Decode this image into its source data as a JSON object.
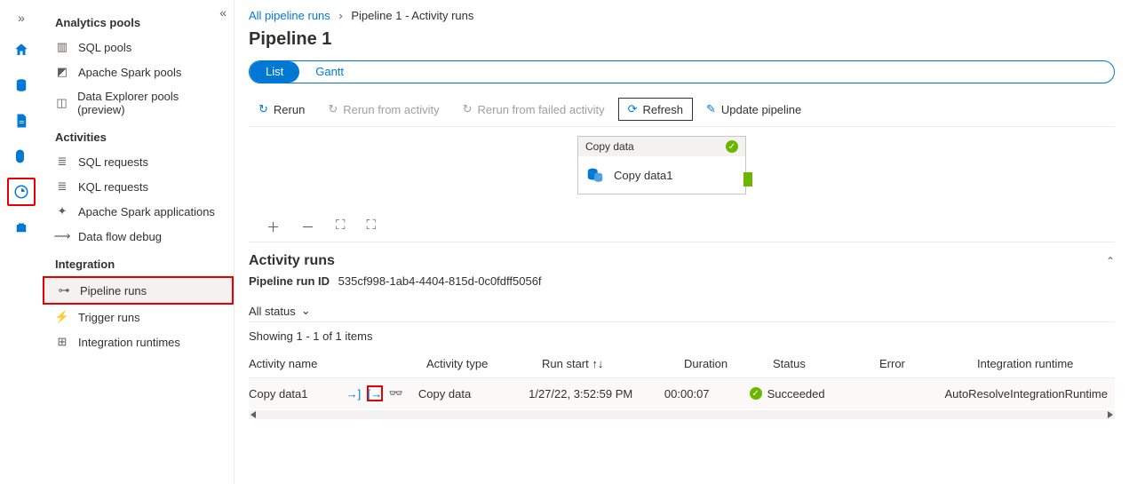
{
  "iconbar": {
    "items": [
      "home",
      "data",
      "develop",
      "integrate",
      "monitor",
      "manage"
    ],
    "selected_index": 4
  },
  "sidebar": {
    "groups": [
      {
        "title": "Analytics pools",
        "items": [
          {
            "label": "SQL pools",
            "icon": "sql-pools-icon"
          },
          {
            "label": "Apache Spark pools",
            "icon": "spark-pools-icon"
          },
          {
            "label": "Data Explorer pools (preview)",
            "icon": "data-explorer-icon"
          }
        ]
      },
      {
        "title": "Activities",
        "items": [
          {
            "label": "SQL requests",
            "icon": "sql-requests-icon"
          },
          {
            "label": "KQL requests",
            "icon": "kql-requests-icon"
          },
          {
            "label": "Apache Spark applications",
            "icon": "spark-apps-icon"
          },
          {
            "label": "Data flow debug",
            "icon": "data-flow-debug-icon"
          }
        ]
      },
      {
        "title": "Integration",
        "items": [
          {
            "label": "Pipeline runs",
            "icon": "pipeline-runs-icon",
            "selected": true
          },
          {
            "label": "Trigger runs",
            "icon": "trigger-runs-icon"
          },
          {
            "label": "Integration runtimes",
            "icon": "integration-runtimes-icon"
          }
        ]
      }
    ]
  },
  "breadcrumb": {
    "root": "All pipeline runs",
    "current": "Pipeline 1 - Activity runs"
  },
  "page_title": "Pipeline 1",
  "view_toggle": {
    "list": "List",
    "gantt": "Gantt"
  },
  "toolbar": {
    "rerun": "Rerun",
    "rerun_from_activity": "Rerun from activity",
    "rerun_from_failed": "Rerun from failed activity",
    "refresh": "Refresh",
    "update_pipeline": "Update pipeline"
  },
  "node": {
    "type": "Copy data",
    "name": "Copy data1"
  },
  "activity_section": {
    "title": "Activity runs",
    "run_id_label": "Pipeline run ID",
    "run_id": "535cf998-1ab4-4404-815d-0c0fdff5056f",
    "filter": "All status",
    "count": "Showing 1 - 1 of 1 items"
  },
  "table": {
    "headers": {
      "name": "Activity name",
      "type": "Activity type",
      "start": "Run start",
      "duration": "Duration",
      "status": "Status",
      "error": "Error",
      "runtime": "Integration runtime"
    },
    "rows": [
      {
        "name": "Copy data1",
        "type": "Copy data",
        "start": "1/27/22, 3:52:59 PM",
        "duration": "00:00:07",
        "status": "Succeeded",
        "error": "",
        "runtime": "AutoResolveIntegrationRuntime"
      }
    ]
  }
}
